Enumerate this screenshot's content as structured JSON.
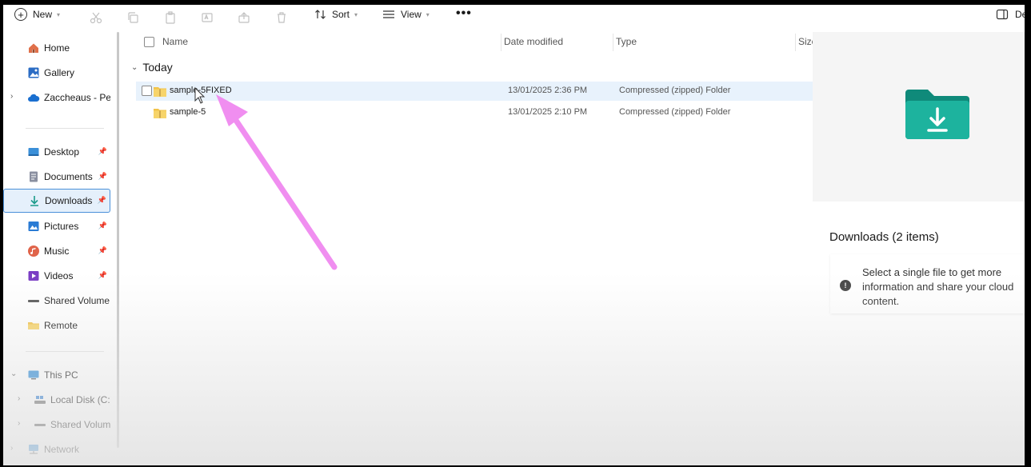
{
  "toolbar": {
    "new_label": "New",
    "sort_label": "Sort",
    "view_label": "View",
    "more_label": "•••",
    "details_label": "De"
  },
  "sidebar": {
    "items": [
      {
        "label": "Home",
        "icon": "home-icon"
      },
      {
        "label": "Gallery",
        "icon": "gallery-icon"
      },
      {
        "label": "Zaccheaus - Per",
        "icon": "cloud-icon"
      },
      {
        "label": "Desktop",
        "icon": "desktop-icon"
      },
      {
        "label": "Documents",
        "icon": "documents-icon"
      },
      {
        "label": "Downloads",
        "icon": "downloads-icon"
      },
      {
        "label": "Pictures",
        "icon": "pictures-icon"
      },
      {
        "label": "Music",
        "icon": "music-icon"
      },
      {
        "label": "Videos",
        "icon": "videos-icon"
      },
      {
        "label": "Shared Volume (",
        "icon": "drive-icon"
      },
      {
        "label": "Remote",
        "icon": "folder-icon"
      },
      {
        "label": "This PC",
        "icon": "pc-icon"
      },
      {
        "label": "Local Disk (C:)",
        "icon": "disk-icon"
      },
      {
        "label": "Shared Volume",
        "icon": "drive-icon"
      },
      {
        "label": "Network",
        "icon": "network-icon"
      }
    ]
  },
  "columns": {
    "name": "Name",
    "date": "Date modified",
    "type": "Type",
    "size": "Size"
  },
  "group": {
    "label": "Today"
  },
  "files": [
    {
      "name": "sample-5FIXED",
      "date": "13/01/2025 2:36 PM",
      "type": "Compressed (zipped) Folder"
    },
    {
      "name": "sample-5",
      "date": "13/01/2025 2:10 PM",
      "type": "Compressed (zipped) Folder"
    }
  ],
  "preview": {
    "title": "Downloads (2 items)",
    "info": "Select a single file to get more information and share your cloud content."
  },
  "colors": {
    "accent": "#4a90d9",
    "selection": "#e5f0fb",
    "annotation_arrow": "#f08ef0",
    "downloads_folder": "#1aa38e"
  }
}
